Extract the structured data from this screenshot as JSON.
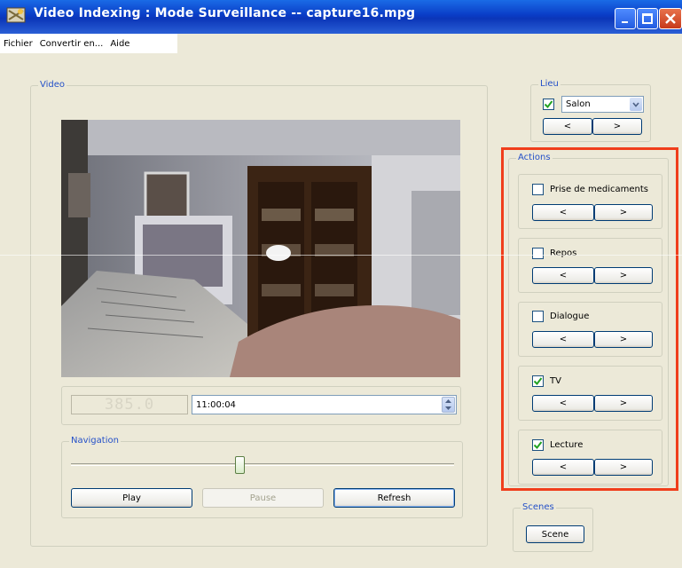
{
  "window": {
    "title": "Video Indexing : Mode Surveillance -- capture16.mpg"
  },
  "menu": [
    "Fichier",
    "Convertir en...",
    "Aide"
  ],
  "video_panel": {
    "legend": "Video",
    "lcd_text": "385.0",
    "time_value": "11:00:04"
  },
  "navigation": {
    "legend": "Navigation",
    "slider_position": 0.44,
    "play_label": "Play",
    "pause_label": "Pause",
    "refresh_label": "Refresh"
  },
  "lieu": {
    "legend": "Lieu",
    "checked": true,
    "selected": "Salon",
    "prev_label": "<",
    "next_label": ">"
  },
  "actions": {
    "legend": "Actions",
    "items": [
      {
        "label": "Prise de medicaments",
        "checked": false,
        "prev": "<",
        "next": ">"
      },
      {
        "label": "Repos",
        "checked": false,
        "prev": "<",
        "next": ">"
      },
      {
        "label": "Dialogue",
        "checked": false,
        "prev": "<",
        "next": ">"
      },
      {
        "label": "TV",
        "checked": true,
        "prev": "<",
        "next": ">"
      },
      {
        "label": "Lecture",
        "checked": true,
        "prev": "<",
        "next": ">"
      }
    ]
  },
  "scenes": {
    "legend": "Scenes",
    "button_label": "Scene"
  },
  "colors": {
    "titlebar": "#0a3cc6",
    "legend_text": "#2450c8",
    "highlight": "#f03e1c",
    "checkmark": "#21a121"
  }
}
